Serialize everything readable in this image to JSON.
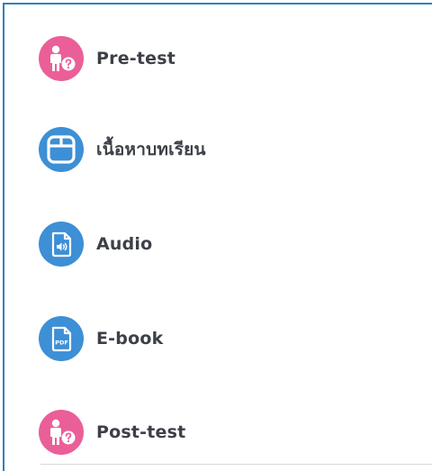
{
  "activities": [
    {
      "label": "Pre-test",
      "icon": "person-question-icon",
      "color": "#ea5f97"
    },
    {
      "label": "เนื้อหาบทเรียน",
      "icon": "content-window-icon",
      "color": "#3d8fd6"
    },
    {
      "label": "Audio",
      "icon": "audio-file-icon",
      "color": "#3d8fd6"
    },
    {
      "label": "E-book",
      "icon": "pdf-file-icon",
      "color": "#3d8fd6"
    },
    {
      "label": "Post-test",
      "icon": "person-question-icon",
      "color": "#ea5f97"
    }
  ],
  "pdf_badge": "PDF"
}
